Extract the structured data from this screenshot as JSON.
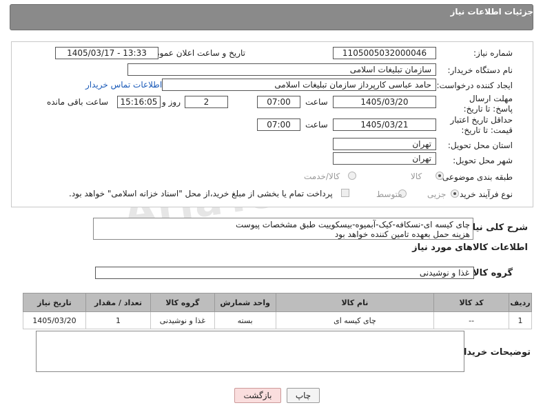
{
  "header": {
    "title": "جزئیات اطلاعات نیاز"
  },
  "form": {
    "need_number_label": "شماره نیاز:",
    "need_number": "1105005032000046",
    "announce_label": "تاریخ و ساعت اعلان عمومی:",
    "announce_value": "1405/03/17 - 13:33",
    "buyer_org_label": "نام دستگاه خریدار:",
    "buyer_org": "سازمان تبلیغات اسلامی",
    "creator_label": "ایجاد کننده درخواست:",
    "creator": "حامد عباسی کارپرداز سازمان تبلیغات اسلامی",
    "contact_link": "اطلاعات تماس خریدار",
    "reply_deadline_label": "مهلت ارسال پاسخ: تا تاریخ:",
    "reply_date": "1405/03/20",
    "time_label": "ساعت",
    "reply_time": "07:00",
    "days_value": "2",
    "days_label": "روز و",
    "remaining_time": "15:16:05",
    "remaining_label": "ساعت باقی مانده",
    "price_validity_label": "حداقل تاریخ اعتبار قیمت: تا تاریخ:",
    "price_date": "1405/03/21",
    "price_time": "07:00",
    "province_label": "استان محل تحویل:",
    "province": "تهران",
    "city_label": "شهر محل تحویل:",
    "city": "تهران",
    "category_label": "طبقه بندی موضوعی:",
    "category_options": [
      "کالا",
      "کالا/خدمت"
    ],
    "process_label": "نوع فرآیند خرید :",
    "process_options": [
      "جزیی",
      "متوسط"
    ],
    "payment_note": "پرداخت تمام یا بخشی از مبلغ خرید،از محل \"اسناد خزانه اسلامی\" خواهد بود."
  },
  "description": {
    "label": "شرح کلی نیاز:",
    "lines": [
      "چای کیسه ای-نسکافه-کیک-آبمیوه-بیسکوییت طبق مشخصات پیوست",
      "هزینه حمل بعهده تامین کننده خواهد بود"
    ]
  },
  "goods_section": {
    "title": "اطلاعات کالاهای مورد نیاز",
    "group_label": "گروه کالا:",
    "group_value": "غذا و نوشیدنی"
  },
  "table": {
    "headers": [
      "ردیف",
      "کد کالا",
      "نام کالا",
      "واحد شمارش",
      "گروه کالا",
      "تعداد / مقدار",
      "تاریخ نیاز"
    ],
    "rows": [
      [
        "1",
        "--",
        "چای کیسه ای",
        "بسته",
        "غذا و نوشیدنی",
        "1",
        "1405/03/20"
      ]
    ]
  },
  "buyer_notes_label": "توضیحات خریدار:",
  "buttons": {
    "print": "چاپ",
    "back": "بازگشت"
  },
  "watermark": "AriaTender.neT"
}
